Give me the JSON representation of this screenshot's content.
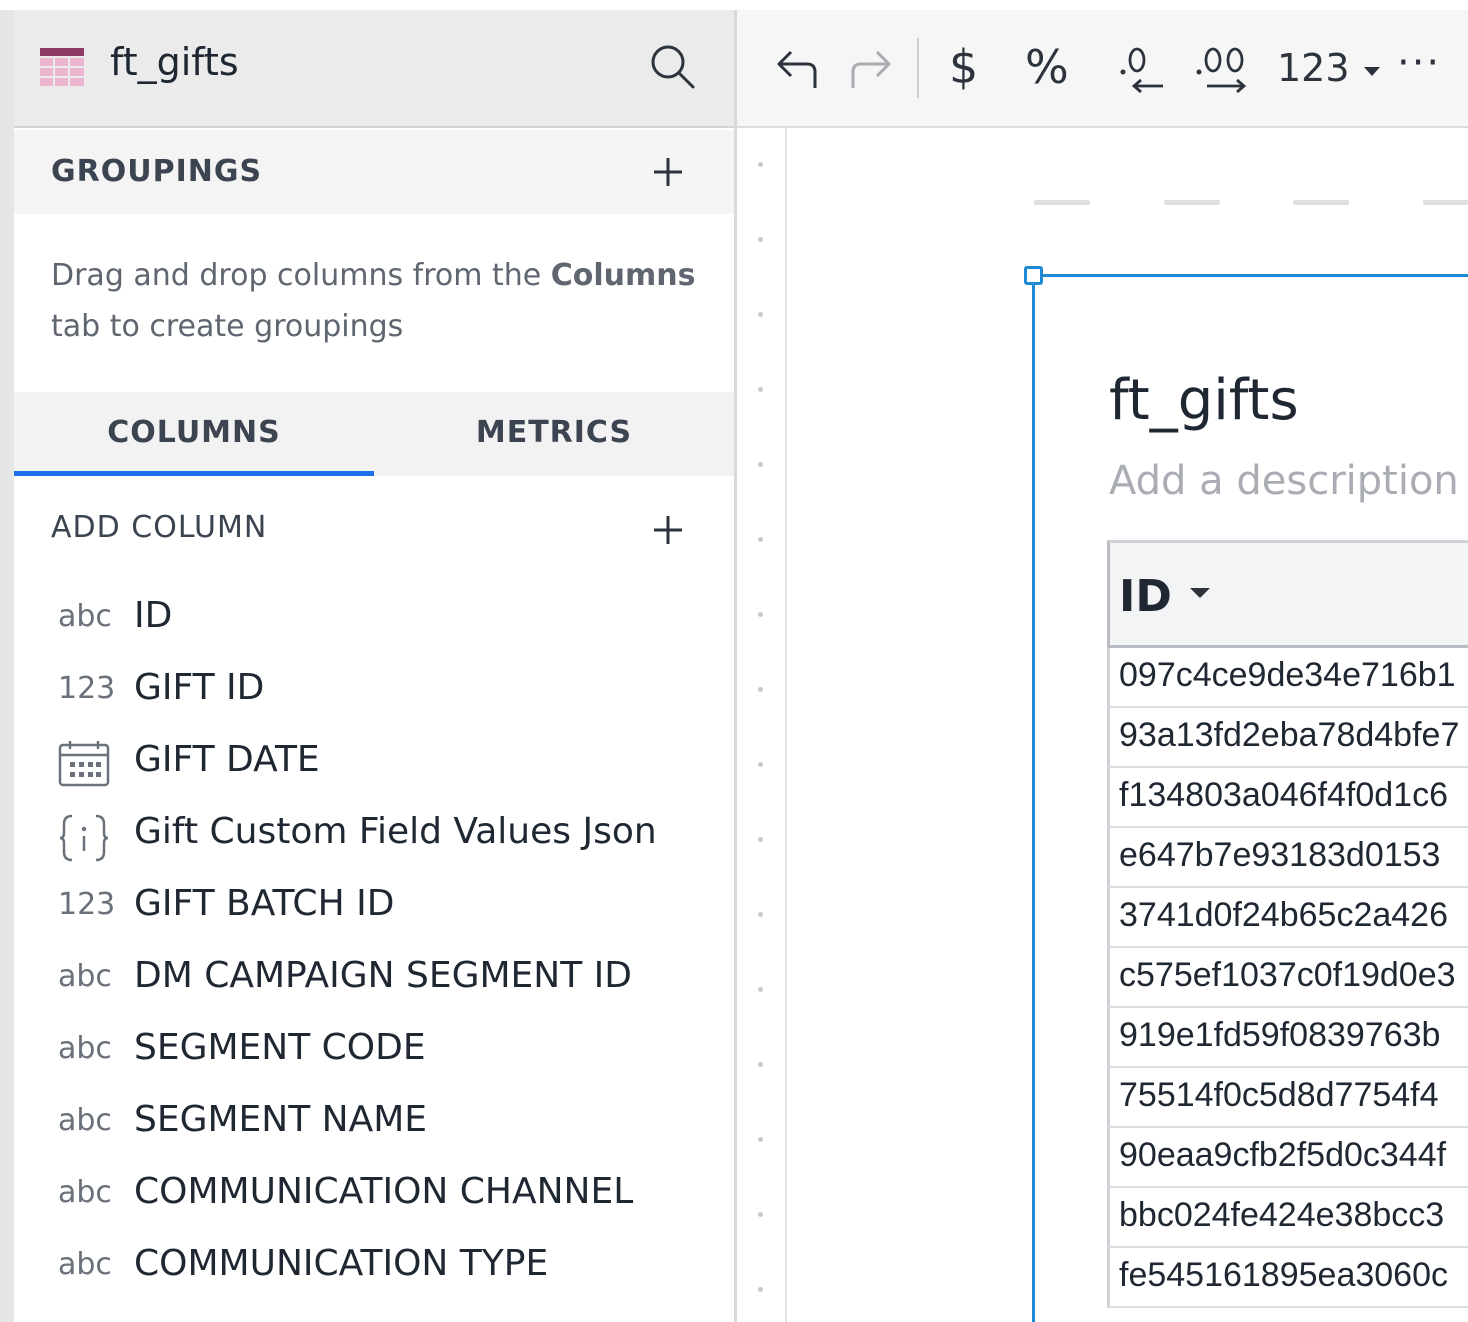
{
  "panel": {
    "title": "ft_gifts",
    "groupings": {
      "label": "GROUPINGS",
      "help_prefix": "Drag and drop columns from the ",
      "help_bold": "Columns",
      "help_suffix": " tab to create groupings"
    },
    "tabs": [
      {
        "label": "COLUMNS",
        "active": true
      },
      {
        "label": "METRICS",
        "active": false
      }
    ],
    "add_column_label": "ADD COLUMN",
    "columns": [
      {
        "type": "abc",
        "name": "ID"
      },
      {
        "type": "123",
        "name": "GIFT ID"
      },
      {
        "type": "calendar-icon",
        "name": "GIFT DATE"
      },
      {
        "type": "json-icon",
        "name": "Gift Custom Field Values Json"
      },
      {
        "type": "123",
        "name": "GIFT BATCH ID"
      },
      {
        "type": "abc",
        "name": "DM CAMPAIGN SEGMENT ID"
      },
      {
        "type": "abc",
        "name": "SEGMENT CODE"
      },
      {
        "type": "abc",
        "name": "SEGMENT NAME"
      },
      {
        "type": "abc",
        "name": "COMMUNICATION CHANNEL"
      },
      {
        "type": "abc",
        "name": "COMMUNICATION TYPE"
      }
    ]
  },
  "toolbar": {
    "undo": "undo-icon",
    "redo": "redo-icon",
    "currency": "$",
    "percent": "%",
    "decrease_decimals": "decrease-decimals-icon",
    "increase_decimals": "increase-decimals-icon",
    "number_format": "123",
    "more": "···"
  },
  "canvas": {
    "table_title": "ft_gifts",
    "description_placeholder": "Add a description",
    "grid": {
      "header": "ID",
      "rows": [
        "097c4ce9de34e716b1",
        "93a13fd2eba78d4bfe7",
        "f134803a046f4f0d1c6",
        "e647b7e93183d0153",
        "3741d0f24b65c2a426",
        "c575ef1037c0f19d0e3",
        "919e1fd59f0839763b",
        "75514f0c5d8d7754f4",
        "90eaa9cfb2f5d0c344f",
        "bbc024fe424e38bcc3",
        "fe545161895ea3060c"
      ]
    }
  },
  "colors": {
    "accent": "#1c6fe8",
    "frame": "#1e8ad6",
    "table_icon": "#8e3a67"
  }
}
